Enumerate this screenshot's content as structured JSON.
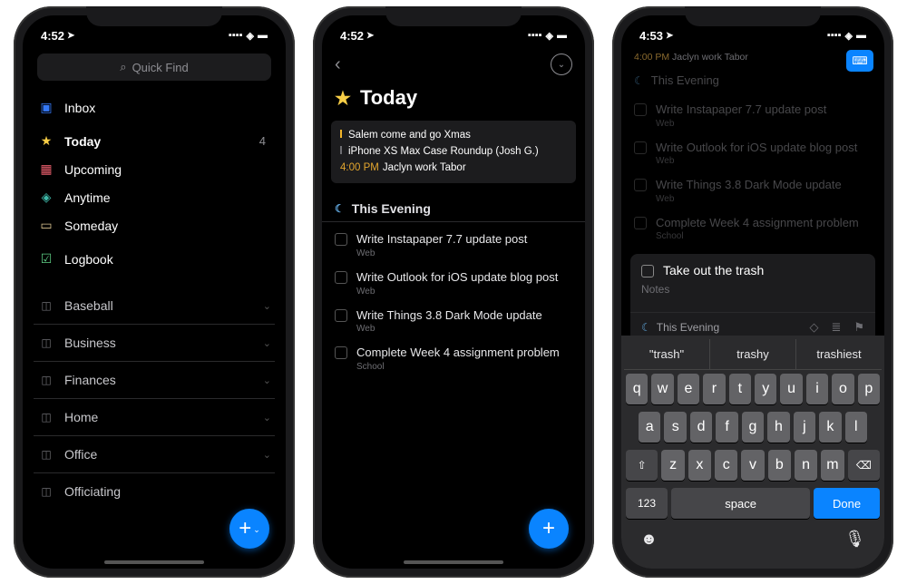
{
  "status": {
    "time1": "4:52",
    "time2": "4:52",
    "time3": "4:53",
    "loc": "➤"
  },
  "search": {
    "placeholder": "Quick Find"
  },
  "nav": {
    "inbox": "Inbox",
    "today": "Today",
    "today_count": "4",
    "upcoming": "Upcoming",
    "anytime": "Anytime",
    "someday": "Someday",
    "logbook": "Logbook"
  },
  "areas": [
    "Baseball",
    "Business",
    "Finances",
    "Home",
    "Office",
    "Officiating"
  ],
  "today_page": {
    "title": "Today",
    "card": {
      "line1": "Salem come and go Xmas",
      "line2": "iPhone XS Max Case Roundup (Josh G.)",
      "line3_time": "4:00 PM",
      "line3_text": "Jaclyn work Tabor"
    },
    "evening": "This Evening",
    "tasks": [
      {
        "title": "Write Instapaper 7.7 update post",
        "sub": "Web"
      },
      {
        "title": "Write Outlook for iOS update blog post",
        "sub": "Web"
      },
      {
        "title": "Write Things 3.8 Dark Mode update",
        "sub": "Web"
      },
      {
        "title": "Complete Week 4 assignment problem",
        "sub": "School"
      }
    ]
  },
  "new_task": {
    "header_time": "4:00 PM",
    "header_text": "Jaclyn work Tabor",
    "evening": "This Evening",
    "title": "Take out the trash",
    "notes": "Notes",
    "when": "This Evening"
  },
  "keyboard": {
    "suggest": [
      "trash",
      "trashy",
      "trashiest"
    ],
    "row1": [
      "q",
      "w",
      "e",
      "r",
      "t",
      "y",
      "u",
      "i",
      "o",
      "p"
    ],
    "row2": [
      "a",
      "s",
      "d",
      "f",
      "g",
      "h",
      "j",
      "k",
      "l"
    ],
    "row3": [
      "z",
      "x",
      "c",
      "v",
      "b",
      "n",
      "m"
    ],
    "shift": "⇧",
    "del": "⌫",
    "num": "123",
    "space": "space",
    "done": "Done",
    "emoji": "☻",
    "mic": "🎤"
  }
}
